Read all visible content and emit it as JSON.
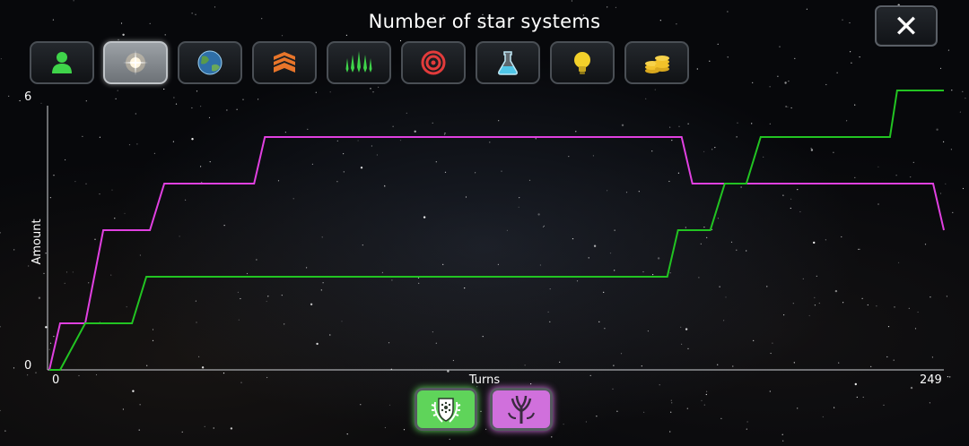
{
  "title": "Number of star systems",
  "close_label": "✕",
  "tabs": [
    {
      "icon": "population-icon",
      "color": "#3fd44a",
      "active": false
    },
    {
      "icon": "star-icon",
      "color": "#ffffff",
      "active": true
    },
    {
      "icon": "planet-icon",
      "color": "#4a90c8",
      "active": false
    },
    {
      "icon": "territory-icon",
      "color": "#e8752a",
      "active": false
    },
    {
      "icon": "fleet-icon",
      "color": "#3fd44a",
      "active": false
    },
    {
      "icon": "military-icon",
      "color": "#e23b3b",
      "active": false
    },
    {
      "icon": "science-flask-icon",
      "color": "#4fc6e8",
      "active": false
    },
    {
      "icon": "lightbulb-icon",
      "color": "#f2d02a",
      "active": false
    },
    {
      "icon": "credits-coins-icon",
      "color": "#f2c22a",
      "active": false
    }
  ],
  "players": [
    {
      "icon": "laurel-shield-emblem-icon",
      "color": "#5fd45a"
    },
    {
      "icon": "tree-emblem-icon",
      "color": "#d070dc"
    }
  ],
  "chart_data": {
    "type": "line",
    "title": "Number of star systems",
    "xlabel": "Turns",
    "ylabel": "Amount",
    "xlim": [
      0,
      249
    ],
    "ylim": [
      0,
      6
    ],
    "x_tick_labels": [
      "0",
      "249"
    ],
    "y_tick_labels": [
      "0",
      "6"
    ],
    "grid": false,
    "series": [
      {
        "color": "#e040e0",
        "points": [
          [
            0,
            0
          ],
          [
            3,
            1
          ],
          [
            10,
            1
          ],
          [
            15,
            3
          ],
          [
            28,
            3
          ],
          [
            32,
            4
          ],
          [
            57,
            4
          ],
          [
            60,
            5
          ],
          [
            176,
            5
          ],
          [
            179,
            4
          ],
          [
            246,
            4
          ],
          [
            249,
            3
          ]
        ]
      },
      {
        "color": "#22c422",
        "points": [
          [
            0,
            0
          ],
          [
            3,
            0
          ],
          [
            10,
            1
          ],
          [
            23,
            1
          ],
          [
            27,
            2
          ],
          [
            172,
            2
          ],
          [
            175,
            3
          ],
          [
            184,
            3
          ],
          [
            188,
            4
          ],
          [
            194,
            4
          ],
          [
            198,
            5
          ],
          [
            234,
            5
          ],
          [
            236,
            6
          ],
          [
            249,
            6
          ]
        ]
      }
    ]
  }
}
